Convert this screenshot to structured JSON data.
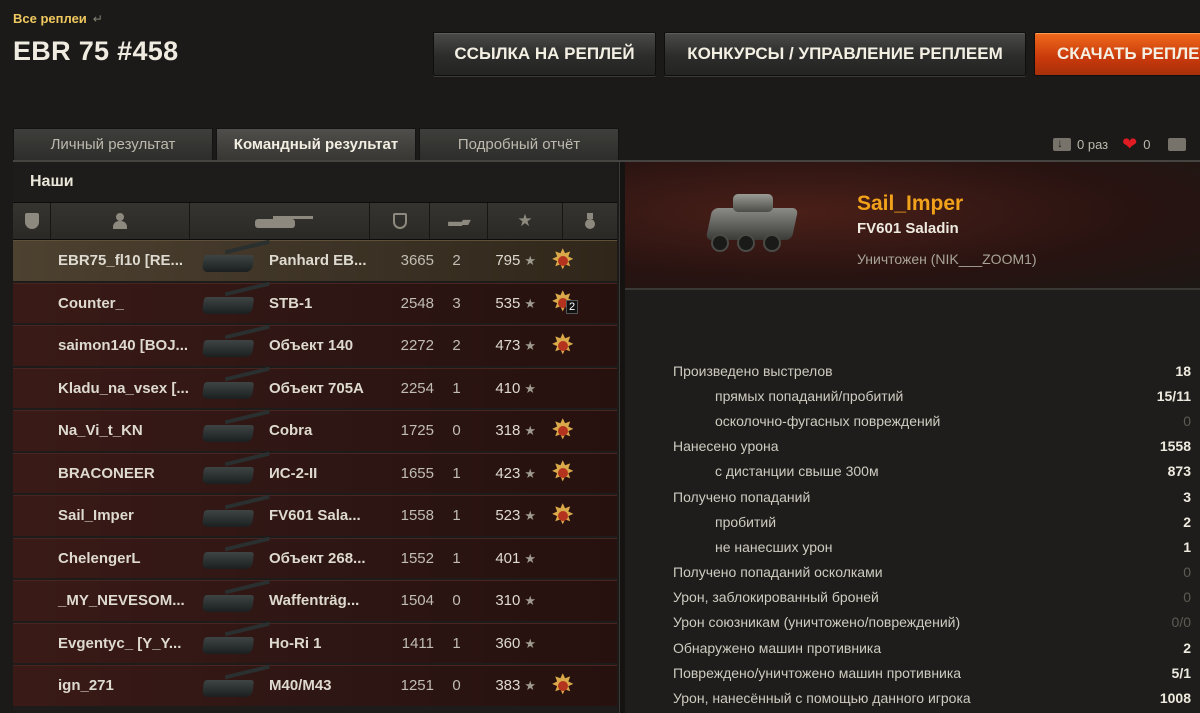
{
  "breadcrumb": {
    "label": "Все реплеи",
    "arrow": "↵"
  },
  "title": "EBR 75 #458",
  "buttons": {
    "link": "ССЫЛКА НА РЕПЛЕЙ",
    "contests": "КОНКУРСЫ / УПРАВЛЕНИЕ РЕПЛЕЕМ",
    "download": "СКАЧАТЬ РЕПЛЕЙ"
  },
  "tabs": [
    "Личный результат",
    "Командный результат",
    "Подробный отчёт"
  ],
  "active_tab": 1,
  "counters": {
    "downloads": "0 раз",
    "likes": "0"
  },
  "team": {
    "label": "Наши",
    "columns": [
      "shield-icon",
      "player-icon",
      "tank-icon",
      "damage-icon",
      "kills-icon",
      "xp-star-icon",
      "medal-icon"
    ],
    "rows": [
      {
        "name": "EBR75_fl10 [RE...",
        "tank": "Panhard EB...",
        "damage": "3665",
        "kills": "2",
        "xp": "795",
        "medal": true,
        "medal_count": "",
        "me": true
      },
      {
        "name": "Counter_",
        "tank": "STB-1",
        "damage": "2548",
        "kills": "3",
        "xp": "535",
        "medal": true,
        "medal_count": "2"
      },
      {
        "name": "saimon140 [BOJ...",
        "tank": "Объект 140",
        "damage": "2272",
        "kills": "2",
        "xp": "473",
        "medal": true,
        "medal_count": ""
      },
      {
        "name": "Kladu_na_vsex [...",
        "tank": "Объект 705А",
        "damage": "2254",
        "kills": "1",
        "xp": "410",
        "medal": false,
        "medal_count": ""
      },
      {
        "name": "Na_Vi_t_KN",
        "tank": "Cobra",
        "damage": "1725",
        "kills": "0",
        "xp": "318",
        "medal": true,
        "medal_count": ""
      },
      {
        "name": "BRACONEER",
        "tank": "ИС-2-II",
        "damage": "1655",
        "kills": "1",
        "xp": "423",
        "medal": true,
        "medal_count": ""
      },
      {
        "name": "Sail_Imper",
        "tank": "FV601 Sala...",
        "damage": "1558",
        "kills": "1",
        "xp": "523",
        "medal": true,
        "medal_count": ""
      },
      {
        "name": "ChelengerL",
        "tank": "Объект 268...",
        "damage": "1552",
        "kills": "1",
        "xp": "401",
        "medal": false,
        "medal_count": ""
      },
      {
        "name": "_MY_NEVESOM...",
        "tank": "Waffenträg...",
        "damage": "1504",
        "kills": "0",
        "xp": "310",
        "medal": false,
        "medal_count": ""
      },
      {
        "name": "Evgentyc_ [Y_Y...",
        "tank": "Ho-Ri 1",
        "damage": "1411",
        "kills": "1",
        "xp": "360",
        "medal": false,
        "medal_count": ""
      },
      {
        "name": "ign_271",
        "tank": "M40/M43",
        "damage": "1251",
        "kills": "0",
        "xp": "383",
        "medal": true,
        "medal_count": ""
      }
    ],
    "star": "★"
  },
  "player": {
    "name": "Sail_Imper",
    "tank": "FV601 Saladin",
    "status": "Уничтожен (NIK___ZOOM1)"
  },
  "stats": [
    {
      "label": "Произведено выстрелов",
      "value": "18",
      "sub": false,
      "dim": false
    },
    {
      "label": "прямых попаданий/пробитий",
      "value": "15/11",
      "sub": true,
      "dim": false
    },
    {
      "label": "осколочно-фугасных повреждений",
      "value": "0",
      "sub": true,
      "dim": true
    },
    {
      "label": "Нанесено урона",
      "value": "1558",
      "sub": false,
      "dim": false
    },
    {
      "label": "с дистанции свыше 300м",
      "value": "873",
      "sub": true,
      "dim": false
    },
    {
      "label": "Получено попаданий",
      "value": "3",
      "sub": false,
      "dim": false
    },
    {
      "label": "пробитий",
      "value": "2",
      "sub": true,
      "dim": false
    },
    {
      "label": "не нанесших урон",
      "value": "1",
      "sub": true,
      "dim": false
    },
    {
      "label": "Получено попаданий осколками",
      "value": "0",
      "sub": false,
      "dim": true
    },
    {
      "label": "Урон, заблокированный броней",
      "value": "0",
      "sub": false,
      "dim": true
    },
    {
      "label": "Урон союзникам (уничтожено/повреждений)",
      "value": "0/0",
      "sub": false,
      "dim": true
    },
    {
      "label": "Обнаружено машин противника",
      "value": "2",
      "sub": false,
      "dim": false
    },
    {
      "label": "Повреждено/уничтожено машин противника",
      "value": "5/1",
      "sub": false,
      "dim": false
    },
    {
      "label": "Урон, нанесённый с помощью данного игрока",
      "value": "1008",
      "sub": false,
      "dim": false
    }
  ]
}
